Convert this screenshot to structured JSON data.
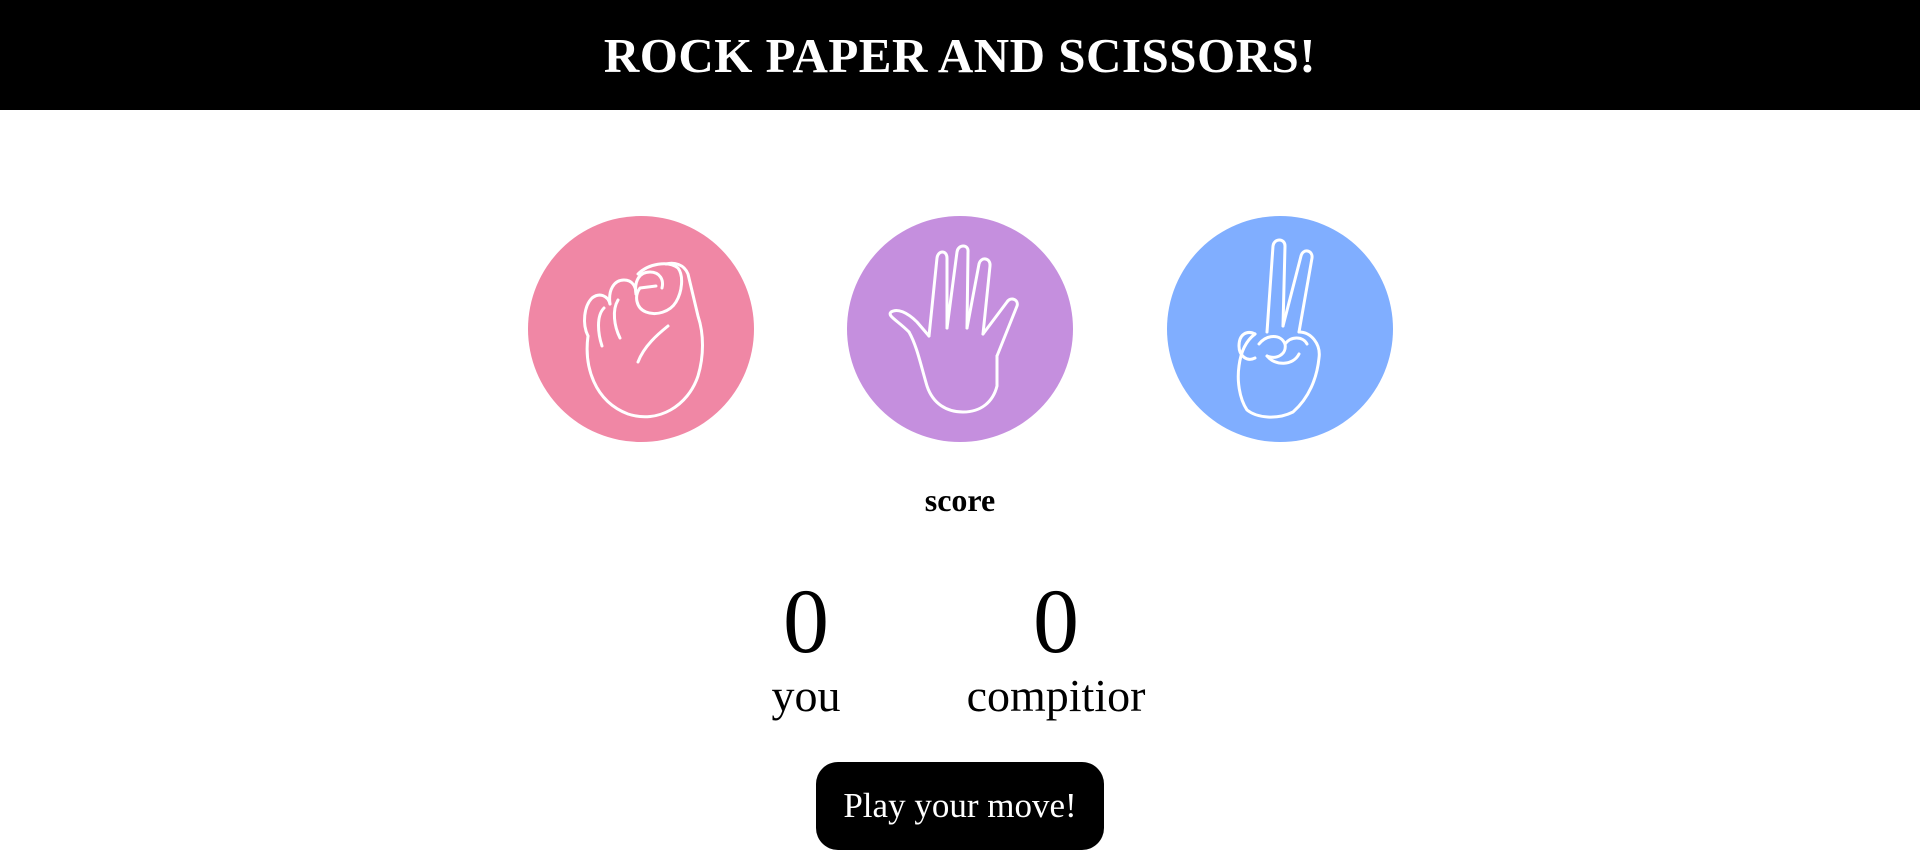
{
  "header": {
    "title": "ROCK PAPER AND SCISSORS!"
  },
  "choices": [
    {
      "id": "rock",
      "icon": "fist-icon",
      "color": "#f087a5"
    },
    {
      "id": "paper",
      "icon": "open-hand-icon",
      "color": "#c58fde"
    },
    {
      "id": "scissors",
      "icon": "peace-hand-icon",
      "color": "#80aeff"
    }
  ],
  "score": {
    "title": "score",
    "user": {
      "value": "0",
      "label": "you"
    },
    "computer": {
      "value": "0",
      "label": "compitior"
    }
  },
  "message": {
    "label": "Play your move!"
  }
}
